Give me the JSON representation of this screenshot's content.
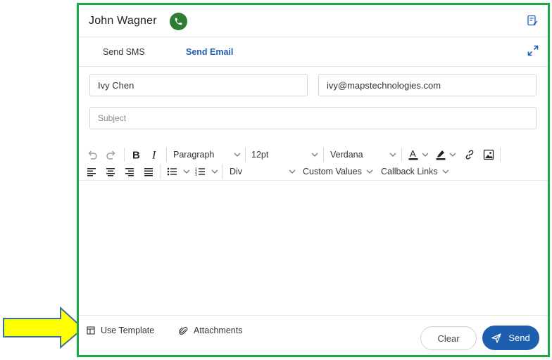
{
  "header": {
    "contact_name": "John Wagner",
    "icons": [
      "phone-icon",
      "note-icon"
    ],
    "call_color": "#2e7d32"
  },
  "tabs": [
    {
      "label": "Send SMS",
      "active": false
    },
    {
      "label": "Send Email",
      "active": true
    }
  ],
  "compose": {
    "from_value": "Ivy Chen",
    "to_value": "ivy@mapstechnologies.com",
    "subject_placeholder": "Subject"
  },
  "toolbar": {
    "block_format": "Paragraph",
    "font_size": "12pt",
    "font_family": "Verdana",
    "container": "Div",
    "custom_values": "Custom Values",
    "callback_links": "Callback Links",
    "icons": [
      "undo-icon",
      "redo-icon",
      "bold-icon",
      "italic-icon",
      "text-color-icon",
      "highlight-icon",
      "link-icon",
      "image-icon",
      "align-left-icon",
      "align-center-icon",
      "align-right-icon",
      "align-justify-icon",
      "bullet-list-icon",
      "numbered-list-icon"
    ]
  },
  "footer": {
    "use_template": "Use Template",
    "attachments": "Attachments",
    "clear": "Clear",
    "send": "Send"
  },
  "colors": {
    "frame_border": "#1fa84a",
    "accent": "#1e5fb4",
    "send_button": "#1d5fae",
    "annotation_arrow": "#ffff00"
  }
}
